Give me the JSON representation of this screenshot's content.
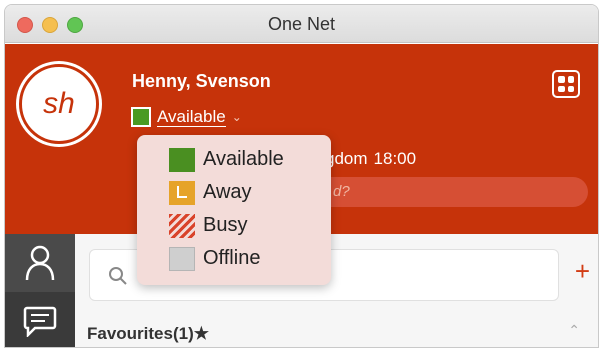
{
  "window": {
    "title": "One Net"
  },
  "profile": {
    "initials": "sh",
    "name": "Henny, Svenson",
    "presence": "Available",
    "location_fragment": "gdom",
    "local_time": "18:00",
    "note_fragment": "d?"
  },
  "presence_menu": {
    "items": [
      {
        "label": "Available",
        "color": "#4a8f21"
      },
      {
        "label": "Away",
        "color": "#e6a329"
      },
      {
        "label": "Busy",
        "color": "#d9432a"
      },
      {
        "label": "Offline",
        "color": "#cfcfcf"
      }
    ]
  },
  "contacts": {
    "search_placeholder": "",
    "add_label": "+",
    "favourites_label": "Favourites(1)★"
  },
  "colors": {
    "brand": "#c6330a",
    "rail": "#3a3a3a"
  },
  "icons": [
    "person-icon",
    "chat-icon",
    "search-icon",
    "grid-menu-icon",
    "chevron-down-icon",
    "chevron-up-icon"
  ]
}
